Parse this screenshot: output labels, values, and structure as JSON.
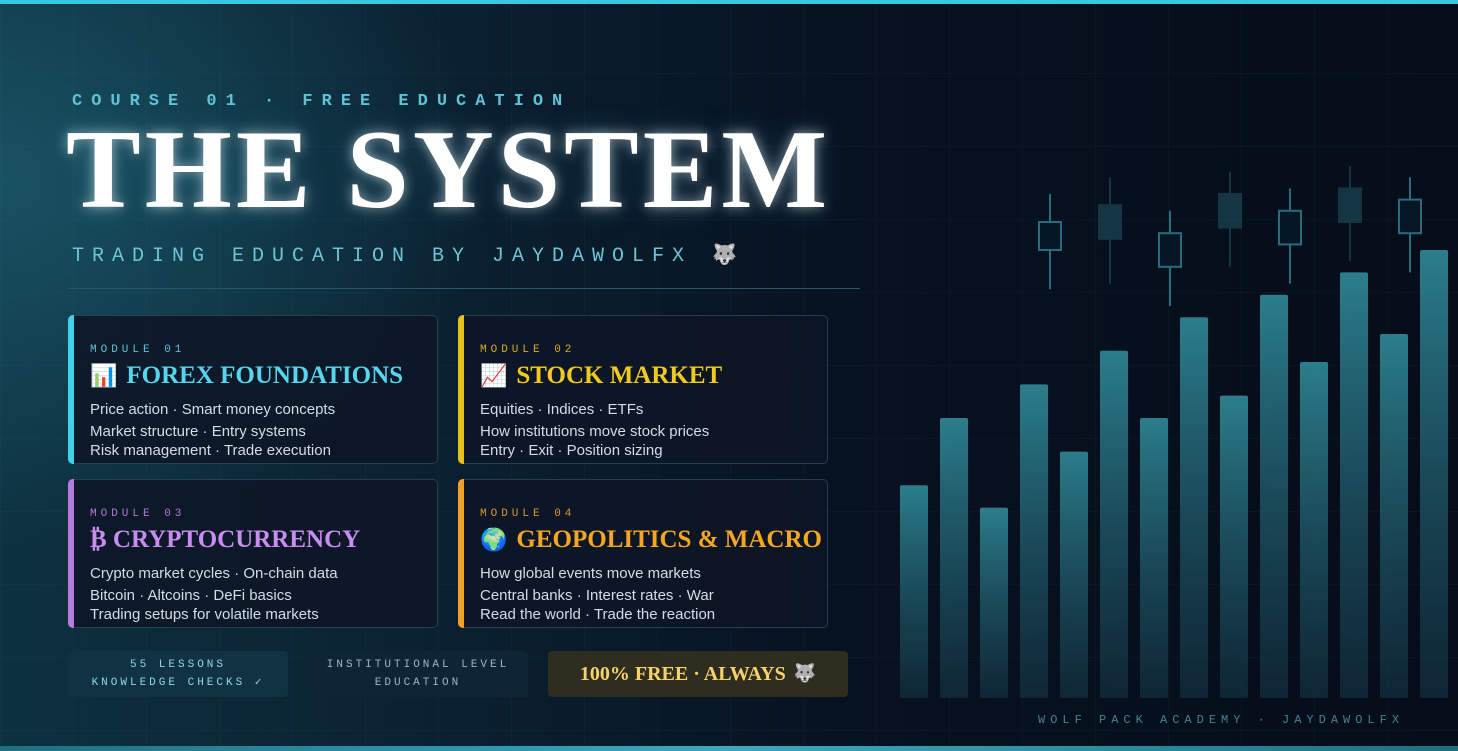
{
  "header": {
    "eyebrow": "COURSE 01 · FREE EDUCATION",
    "title": "THE SYSTEM",
    "subtitle": "TRADING EDUCATION BY JAYDAWOLFX 🐺"
  },
  "modules": [
    {
      "label": "MODULE 01",
      "icon": "📊",
      "title": "FOREX FOUNDATIONS",
      "lines": [
        "Price action · Smart money concepts",
        "Market structure · Entry systems",
        "Risk management · Trade execution"
      ],
      "color": "#3fd2ea"
    },
    {
      "label": "MODULE 02",
      "icon": "📈",
      "title": "STOCK MARKET",
      "lines": [
        "Equities · Indices · ETFs",
        "How institutions move stock prices",
        "Entry · Exit · Position sizing"
      ],
      "color": "#e8c21c"
    },
    {
      "label": "MODULE 03",
      "icon": "",
      "title": "₿ CRYPTOCURRENCY",
      "lines": [
        "Crypto market cycles · On-chain data",
        "Bitcoin · Altcoins · DeFi basics",
        "Trading setups for volatile markets"
      ],
      "color": "#b67ae0"
    },
    {
      "label": "MODULE 04",
      "icon": "🌍",
      "title": "GEOPOLITICS & MACRO",
      "lines": [
        "How global events move markets",
        "Central banks · Interest rates · War",
        "Read the world · Trade the reaction"
      ],
      "color": "#f0a024"
    }
  ],
  "badges": {
    "lessons_line1": "55 LESSONS",
    "lessons_line2": "KNOWLEDGE CHECKS ✓",
    "level_line1": "INSTITUTIONAL LEVEL",
    "level_line2": "EDUCATION",
    "free_text": "100% FREE · ALWAYS",
    "free_icon": "🐺"
  },
  "footer": "WOLF PACK ACADEMY · JAYDAWOLFX",
  "decor_chart": {
    "bar_values": [
      0.38,
      0.5,
      0.34,
      0.56,
      0.44,
      0.62,
      0.5,
      0.68,
      0.54,
      0.72,
      0.6,
      0.76,
      0.65,
      0.8
    ],
    "candles": [
      {
        "high": 0.9,
        "open": 0.85,
        "close": 0.8,
        "low": 0.73
      },
      {
        "high": 0.93,
        "open": 0.88,
        "close": 0.82,
        "low": 0.74
      },
      {
        "high": 0.87,
        "open": 0.83,
        "close": 0.77,
        "low": 0.7
      },
      {
        "high": 0.94,
        "open": 0.9,
        "close": 0.84,
        "low": 0.77
      },
      {
        "high": 0.91,
        "open": 0.87,
        "close": 0.81,
        "low": 0.74
      },
      {
        "high": 0.95,
        "open": 0.91,
        "close": 0.85,
        "low": 0.78
      },
      {
        "high": 0.93,
        "open": 0.89,
        "close": 0.83,
        "low": 0.76
      }
    ],
    "bar_color": "#2f8a98",
    "candle_color": "#2e7d90"
  }
}
